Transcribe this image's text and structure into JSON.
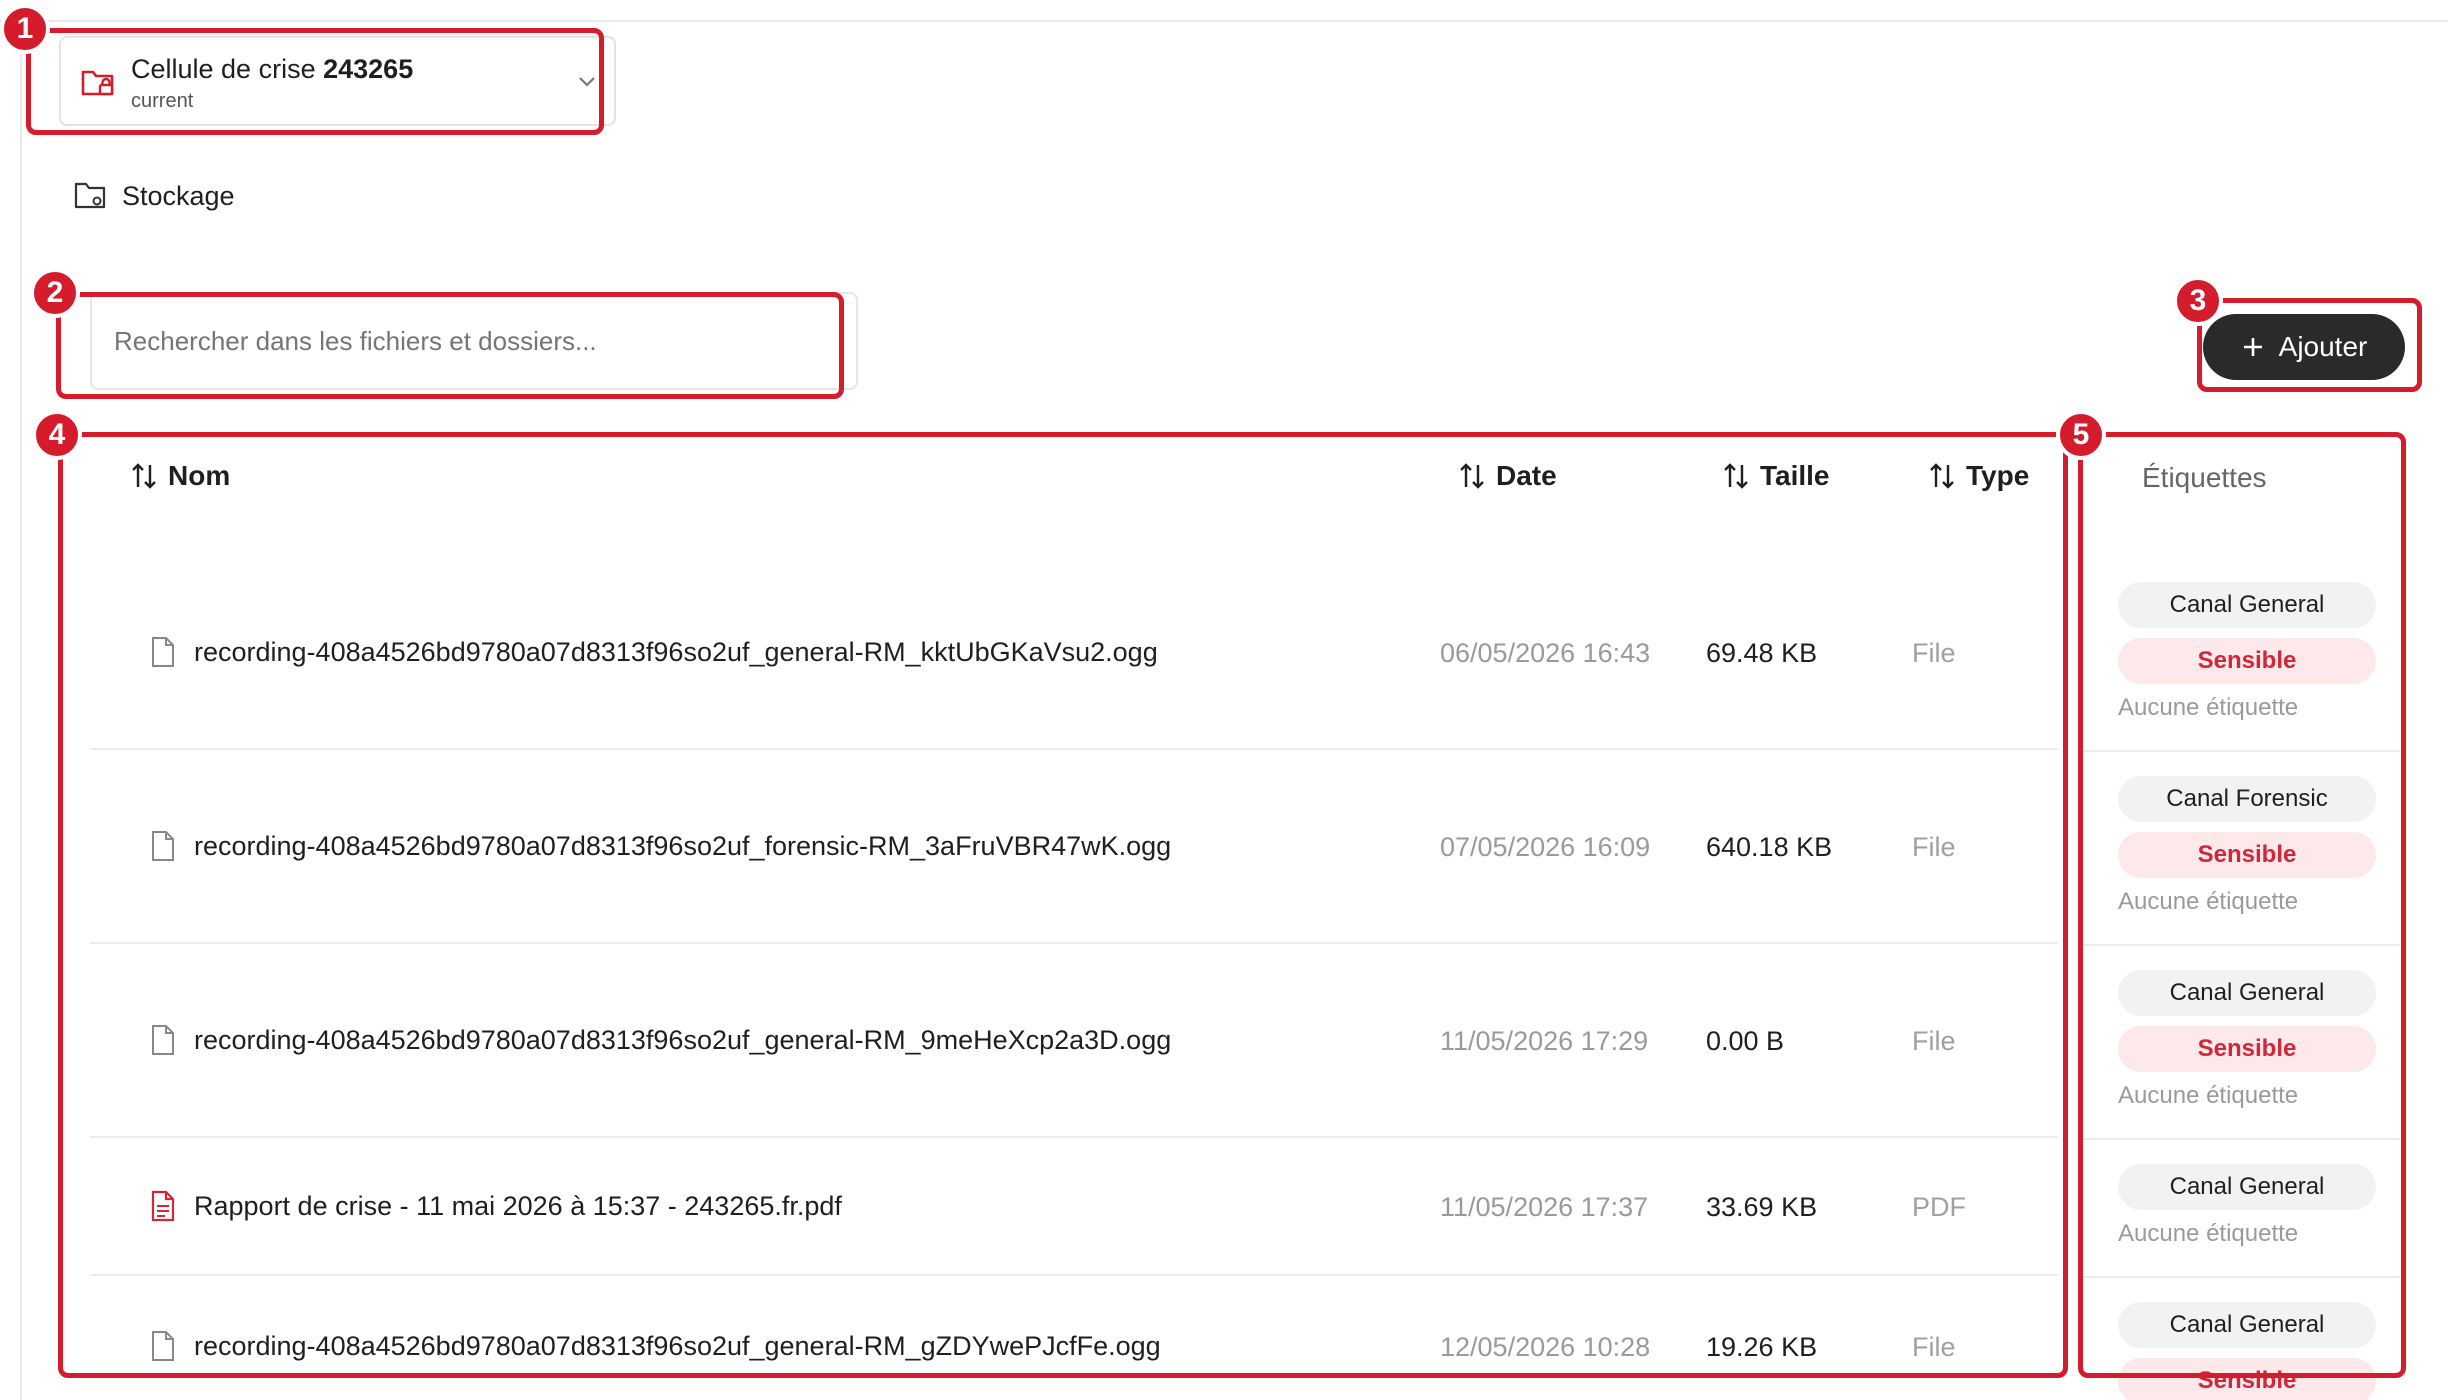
{
  "workspace": {
    "title_prefix": "Cellule de crise",
    "title_number": "243265",
    "subtitle": "current",
    "icon": "folder-lock-icon",
    "chevron": "chevron-down-icon"
  },
  "nav": {
    "storage_label": "Stockage",
    "storage_icon": "folder-settings-icon"
  },
  "search": {
    "placeholder": "Rechercher dans les fichiers et dossiers..."
  },
  "add_button": {
    "label": "Ajouter",
    "icon": "plus-icon"
  },
  "table": {
    "columns": {
      "name": "Nom",
      "date": "Date",
      "size": "Taille",
      "type": "Type",
      "tags": "Étiquettes"
    },
    "rows": [
      {
        "name": "recording-408a4526bd9780a07d8313f96so2uf_general-RM_kktUbGKaVsu2.ogg",
        "date": "06/05/2026 16:43",
        "size": "69.48 KB",
        "type": "File",
        "tags": [
          "Canal General",
          "Sensible"
        ],
        "no_tag": "Aucune étiquette"
      },
      {
        "name": "recording-408a4526bd9780a07d8313f96so2uf_forensic-RM_3aFruVBR47wK.ogg",
        "date": "07/05/2026 16:09",
        "size": "640.18 KB",
        "type": "File",
        "tags": [
          "Canal Forensic",
          "Sensible"
        ],
        "no_tag": "Aucune étiquette"
      },
      {
        "name": "recording-408a4526bd9780a07d8313f96so2uf_general-RM_9meHeXcp2a3D.ogg",
        "date": "11/05/2026 17:29",
        "size": "0.00 B",
        "type": "File",
        "tags": [
          "Canal General",
          "Sensible"
        ],
        "no_tag": "Aucune étiquette"
      },
      {
        "name": "Rapport de crise - 11 mai 2026 à 15:37 - 243265.fr.pdf",
        "date": "11/05/2026 17:37",
        "size": "33.69 KB",
        "type": "PDF",
        "tags": [
          "Canal General"
        ],
        "no_tag": "Aucune étiquette"
      },
      {
        "name": "recording-408a4526bd9780a07d8313f96so2uf_general-RM_gZDYwePJcfFe.ogg",
        "date": "12/05/2026 10:28",
        "size": "19.26 KB",
        "type": "File",
        "tags": [
          "Canal General",
          "Sensible"
        ]
      }
    ]
  },
  "annotations": [
    "1",
    "2",
    "3",
    "4",
    "5"
  ],
  "colors": {
    "annotation": "#d41c2c",
    "accent_red": "#d0273a",
    "button_dark": "#2a2a2a"
  }
}
